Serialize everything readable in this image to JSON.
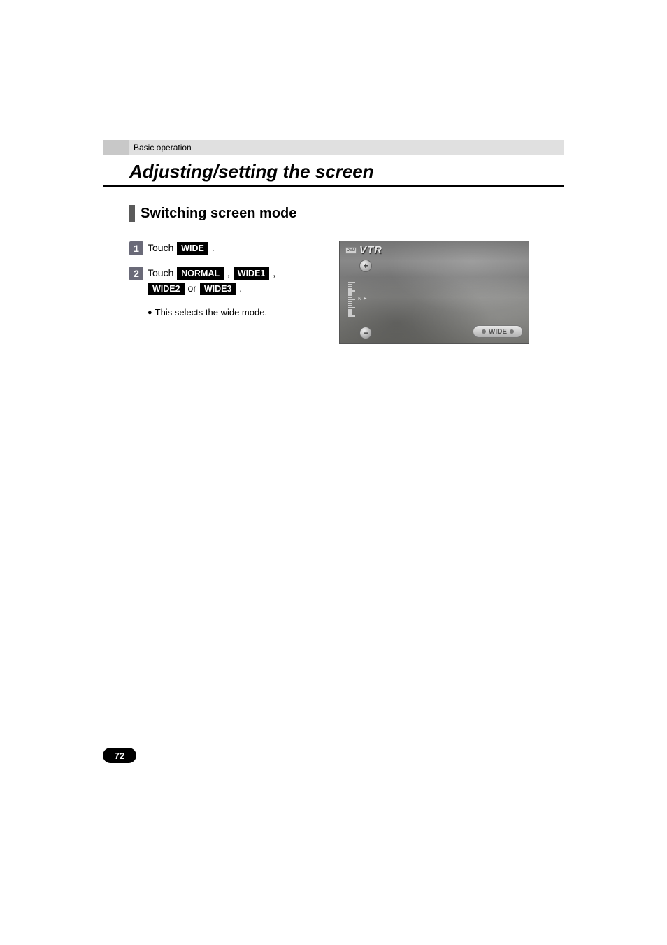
{
  "header": {
    "section_label": "Basic operation",
    "page_title": "Adjusting/setting the screen"
  },
  "subsection": {
    "title": "Switching screen mode"
  },
  "steps": [
    {
      "num": "1",
      "prefix": "Touch ",
      "buttons": [
        "WIDE"
      ],
      "suffix": " ."
    },
    {
      "num": "2",
      "prefix": "Touch ",
      "buttons_seq": [
        {
          "label": "NORMAL",
          "after": " , "
        },
        {
          "label": "WIDE1",
          "after": " , "
        },
        {
          "label": "WIDE2",
          "after": " or "
        },
        {
          "label": "WIDE3",
          "after": " ."
        }
      ],
      "note": "This selects the wide mode."
    }
  ],
  "screenshot": {
    "source_badge_text": "VTR",
    "wide_chip": "WIDE",
    "icon_label": "DVD"
  },
  "page_number": "72"
}
